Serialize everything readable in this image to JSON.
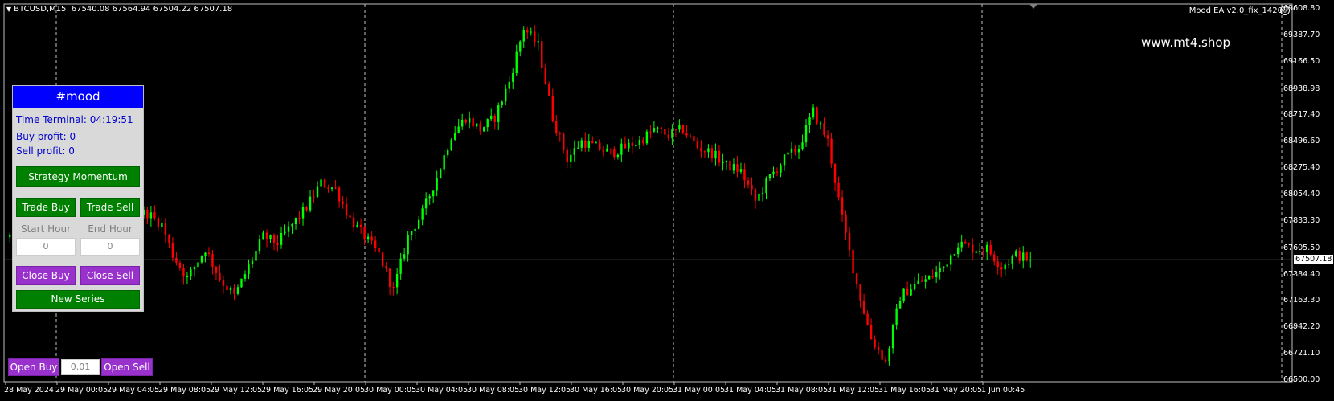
{
  "header": {
    "symbol": "BTCUSD,M15",
    "ohlc": "67540.08 67564.94 67504.22 67507.18"
  },
  "ea_label": "Mood EA  v2.0_fix_1420",
  "watermark": "www.mt4.shop",
  "current_price": "67507.18",
  "price_axis": [
    "69608.80",
    "69387.70",
    "69166.50",
    "68938.98",
    "68717.40",
    "68496.60",
    "68275.40",
    "68054.40",
    "67833.30",
    "67605.50",
    "67384.40",
    "67163.30",
    "66942.20",
    "66721.10",
    "66500.00"
  ],
  "time_axis": [
    "28 May 2024",
    "29 May 00:05",
    "29 May 04:05",
    "29 May 08:05",
    "29 May 12:05",
    "29 May 16:05",
    "29 May 20:05",
    "30 May 00:05",
    "30 May 04:05",
    "30 May 08:05",
    "30 May 12:05",
    "30 May 16:05",
    "30 May 20:05",
    "31 May 00:05",
    "31 May 04:05",
    "31 May 08:05",
    "31 May 12:05",
    "31 May 16:05",
    "31 May 20:05",
    "1 Jun 00:45"
  ],
  "panel": {
    "title": "#mood",
    "time_terminal": "Time Terminal: 04:19:51",
    "buy_profit": "Buy profit: 0",
    "sell_profit": "Sell profit: 0",
    "strategy_btn": "Strategy Momentum",
    "trade_buy": "Trade Buy",
    "trade_sell": "Trade Sell",
    "start_hour_label": "Start Hour",
    "end_hour_label": "End Hour",
    "start_hour": "0",
    "end_hour": "0",
    "close_buy": "Close Buy",
    "close_sell": "Close Sell",
    "new_series": "New Series"
  },
  "order_bar": {
    "open_buy": "Open Buy",
    "lot": "0.01",
    "open_sell": "Open Sell"
  },
  "chart_data": {
    "type": "candlestick",
    "symbol": "BTCUSD",
    "timeframe": "M15",
    "ylim": [
      66500.0,
      69608.8
    ],
    "last": 67507.18,
    "bull_color": "#00ff00",
    "bear_color": "#ff0000",
    "path": [
      [
        0,
        67700
      ],
      [
        4,
        68250
      ],
      [
        8,
        68720
      ],
      [
        13,
        68500
      ],
      [
        18,
        68050
      ],
      [
        20,
        67620
      ],
      [
        24,
        67900
      ],
      [
        30,
        67950
      ],
      [
        34,
        67900
      ],
      [
        38,
        67900
      ],
      [
        42,
        67800
      ],
      [
        45,
        67550
      ],
      [
        49,
        67350
      ],
      [
        54,
        67600
      ],
      [
        58,
        67350
      ],
      [
        62,
        67200
      ],
      [
        66,
        67450
      ],
      [
        70,
        67700
      ],
      [
        74,
        67650
      ],
      [
        78,
        67800
      ],
      [
        82,
        67950
      ],
      [
        86,
        68150
      ],
      [
        90,
        68100
      ],
      [
        94,
        67850
      ],
      [
        98,
        67700
      ],
      [
        102,
        67550
      ],
      [
        106,
        67250
      ],
      [
        110,
        67700
      ],
      [
        114,
        67900
      ],
      [
        118,
        68200
      ],
      [
        122,
        68550
      ],
      [
        126,
        68700
      ],
      [
        130,
        68600
      ],
      [
        134,
        68700
      ],
      [
        138,
        69000
      ],
      [
        142,
        69450
      ],
      [
        146,
        69300
      ],
      [
        150,
        68700
      ],
      [
        154,
        68350
      ],
      [
        158,
        68500
      ],
      [
        162,
        68450
      ],
      [
        166,
        68400
      ],
      [
        170,
        68450
      ],
      [
        174,
        68500
      ],
      [
        178,
        68600
      ],
      [
        182,
        68550
      ],
      [
        186,
        68600
      ],
      [
        190,
        68450
      ],
      [
        194,
        68400
      ],
      [
        198,
        68300
      ],
      [
        202,
        68250
      ],
      [
        206,
        68000
      ],
      [
        210,
        68200
      ],
      [
        214,
        68350
      ],
      [
        218,
        68450
      ],
      [
        222,
        68750
      ],
      [
        226,
        68500
      ],
      [
        230,
        67850
      ],
      [
        234,
        67300
      ],
      [
        238,
        66850
      ],
      [
        242,
        66650
      ],
      [
        246,
        67200
      ],
      [
        250,
        67300
      ],
      [
        254,
        67350
      ],
      [
        258,
        67450
      ],
      [
        262,
        67650
      ],
      [
        266,
        67600
      ],
      [
        270,
        67600
      ],
      [
        274,
        67450
      ],
      [
        278,
        67550
      ],
      [
        282,
        67507.18
      ]
    ]
  }
}
